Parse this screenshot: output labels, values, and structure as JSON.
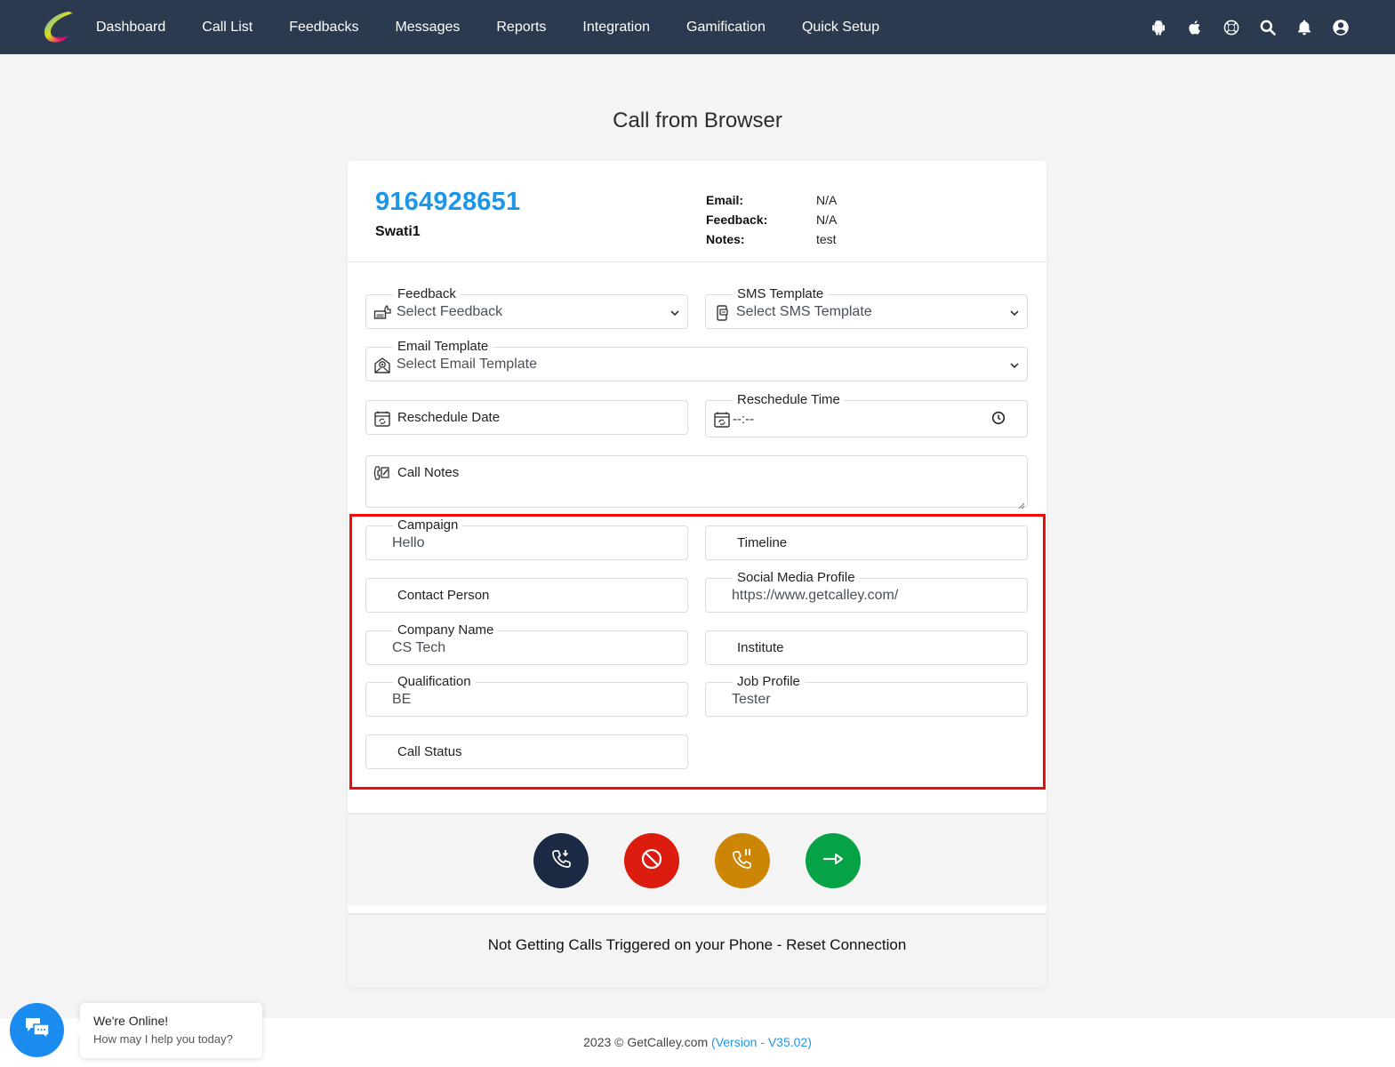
{
  "nav": {
    "logo_alt": "GetCalley logo",
    "links": [
      "Dashboard",
      "Call List",
      "Feedbacks",
      "Messages",
      "Reports",
      "Integration",
      "Gamification",
      "Quick Setup"
    ],
    "icons": [
      "android-icon",
      "apple-icon",
      "help-lifebuoy-icon",
      "search-icon",
      "bell-icon",
      "user-account-icon"
    ]
  },
  "page": {
    "title": "Call from Browser"
  },
  "contact": {
    "phone": "9164928651",
    "name": "Swati1",
    "info": [
      {
        "label": "Email:",
        "value": "N/A"
      },
      {
        "label": "Feedback:",
        "value": "N/A"
      },
      {
        "label": "Notes:",
        "value": "test"
      }
    ]
  },
  "form": {
    "feedback": {
      "legend": "Feedback",
      "value": "Select Feedback"
    },
    "sms_template": {
      "legend": "SMS Template",
      "value": "Select SMS Template"
    },
    "email_template": {
      "legend": "Email Template",
      "value": "Select Email Template"
    },
    "reschedule_date": {
      "placeholder": "Reschedule Date"
    },
    "reschedule_time": {
      "legend": "Reschedule Time",
      "value": "--:--"
    },
    "call_notes": {
      "placeholder": "Call Notes"
    }
  },
  "custom_fields": [
    {
      "label": "Campaign",
      "value": "Hello"
    },
    {
      "label": "Timeline",
      "value": ""
    },
    {
      "label": "Contact Person",
      "value": ""
    },
    {
      "label": "Social Media Profile",
      "value": "https://www.getcalley.com/"
    },
    {
      "label": "Company Name",
      "value": "CS Tech"
    },
    {
      "label": "Institute",
      "value": ""
    },
    {
      "label": "Qualification",
      "value": "BE"
    },
    {
      "label": "Job Profile",
      "value": "Tester"
    },
    {
      "label": "Call Status",
      "value": ""
    }
  ],
  "actions": [
    {
      "name": "call-button",
      "icon": "phone-incoming-icon",
      "color": "#1b2a42"
    },
    {
      "name": "end-call-button",
      "icon": "ban-icon",
      "color": "#dc1c0e"
    },
    {
      "name": "hold-call-button",
      "icon": "phone-pause-icon",
      "color": "#cc8505"
    },
    {
      "name": "next-call-button",
      "icon": "arrow-right-icon",
      "color": "#06a246"
    }
  ],
  "reset": {
    "text": "Not Getting Calls Triggered on your Phone - Reset Connection"
  },
  "footer": {
    "copyright": "2023 © GetCalley.com ",
    "version": "(Version - V35.02)"
  },
  "chat": {
    "title": "We're Online!",
    "subtitle": "How may I help you today?"
  },
  "colors": {
    "navbar": "#2b3a4f",
    "accent": "#1e96e8",
    "highlight": "#ee0b0b"
  }
}
